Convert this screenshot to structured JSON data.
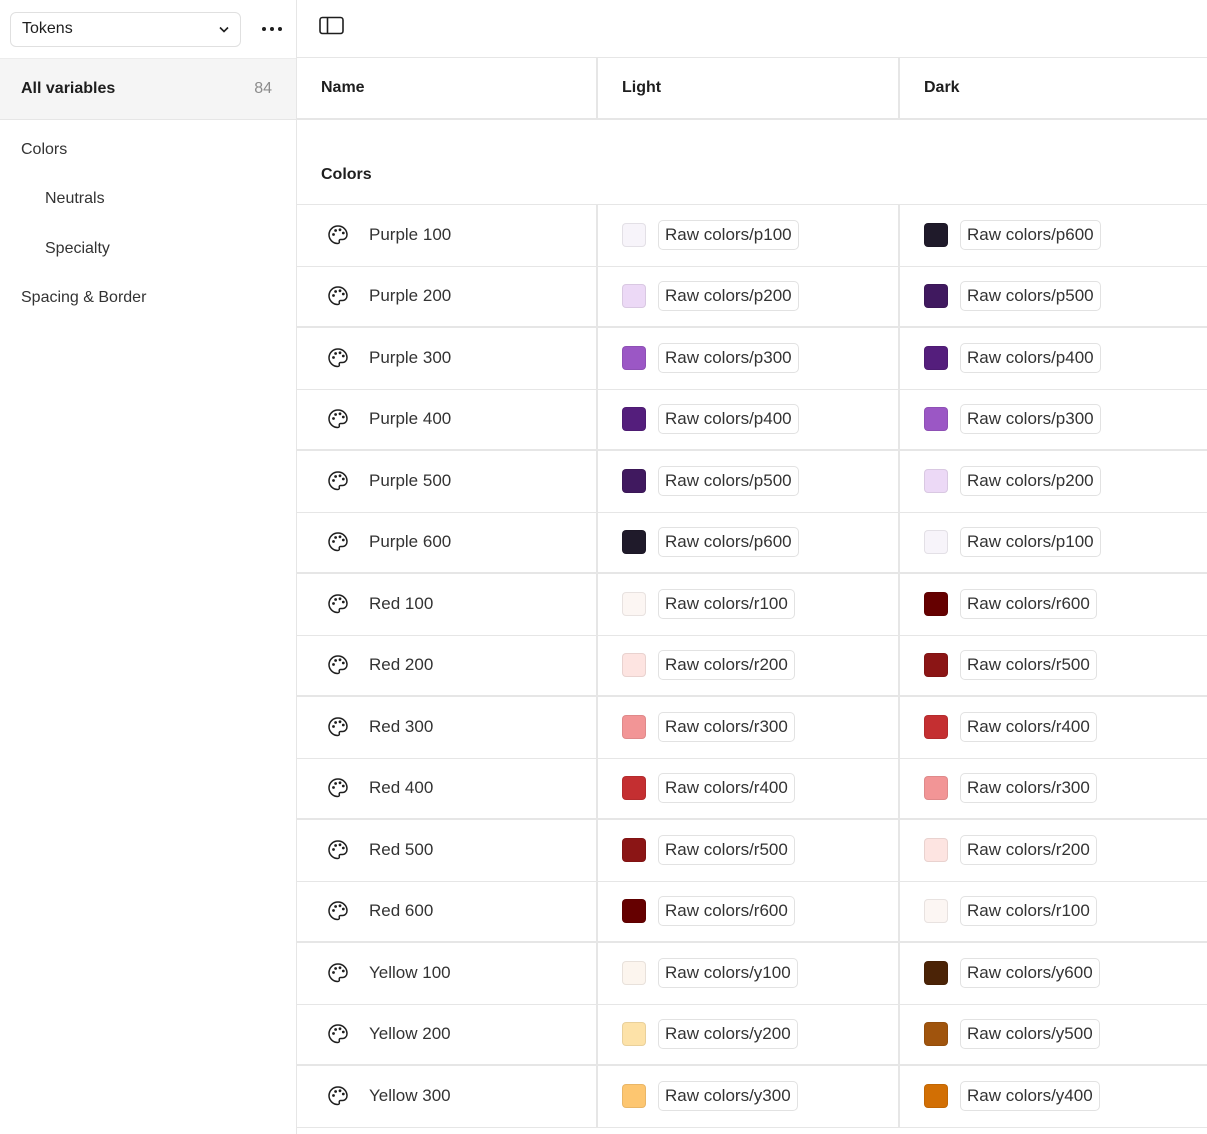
{
  "sidebar": {
    "collection": "Tokens",
    "all_variables": {
      "label": "All variables",
      "count": "84"
    },
    "groups": [
      {
        "label": "Colors",
        "level": 0
      },
      {
        "label": "Neutrals",
        "level": 1
      },
      {
        "label": "Specialty",
        "level": 1
      },
      {
        "label": "Spacing & Border",
        "level": 0
      }
    ]
  },
  "table": {
    "headers": {
      "name": "Name",
      "light": "Light",
      "dark": "Dark"
    },
    "section": "Colors",
    "rows": [
      {
        "name": "Purple 100",
        "light": "Raw colors/p100",
        "light_color": "#f7f4fa",
        "dark": "Raw colors/p600",
        "dark_color": "#1f1a2a"
      },
      {
        "name": "Purple 200",
        "light": "Raw colors/p200",
        "light_color": "#ecd9f6",
        "dark": "Raw colors/p500",
        "dark_color": "#40195f"
      },
      {
        "name": "Purple 300",
        "light": "Raw colors/p300",
        "light_color": "#9b57c5",
        "dark": "Raw colors/p400",
        "dark_color": "#541e7c"
      },
      {
        "name": "Purple 400",
        "light": "Raw colors/p400",
        "light_color": "#541e7c",
        "dark": "Raw colors/p300",
        "dark_color": "#9b57c5"
      },
      {
        "name": "Purple 500",
        "light": "Raw colors/p500",
        "light_color": "#40195f",
        "dark": "Raw colors/p200",
        "dark_color": "#ecd9f6"
      },
      {
        "name": "Purple 600",
        "light": "Raw colors/p600",
        "light_color": "#1f1a2a",
        "dark": "Raw colors/p100",
        "dark_color": "#f7f4fa"
      },
      {
        "name": "Red 100",
        "light": "Raw colors/r100",
        "light_color": "#fcf6f3",
        "dark": "Raw colors/r600",
        "dark_color": "#650000"
      },
      {
        "name": "Red 200",
        "light": "Raw colors/r200",
        "light_color": "#fde4e1",
        "dark": "Raw colors/r500",
        "dark_color": "#8b1515"
      },
      {
        "name": "Red 300",
        "light": "Raw colors/r300",
        "light_color": "#f29596",
        "dark": "Raw colors/r400",
        "dark_color": "#c42f31"
      },
      {
        "name": "Red 400",
        "light": "Raw colors/r400",
        "light_color": "#c42f31",
        "dark": "Raw colors/r300",
        "dark_color": "#f29596"
      },
      {
        "name": "Red 500",
        "light": "Raw colors/r500",
        "light_color": "#8b1515",
        "dark": "Raw colors/r200",
        "dark_color": "#fde4e1"
      },
      {
        "name": "Red 600",
        "light": "Raw colors/r600",
        "light_color": "#650000",
        "dark": "Raw colors/r100",
        "dark_color": "#fcf6f3"
      },
      {
        "name": "Yellow 100",
        "light": "Raw colors/y100",
        "light_color": "#fcf5ee",
        "dark": "Raw colors/y600",
        "dark_color": "#4b2306"
      },
      {
        "name": "Yellow 200",
        "light": "Raw colors/y200",
        "light_color": "#fde2a8",
        "dark": "Raw colors/y500",
        "dark_color": "#a0540d"
      },
      {
        "name": "Yellow 300",
        "light": "Raw colors/y300",
        "light_color": "#fdc670",
        "dark": "Raw colors/y400",
        "dark_color": "#d26f04"
      }
    ]
  }
}
